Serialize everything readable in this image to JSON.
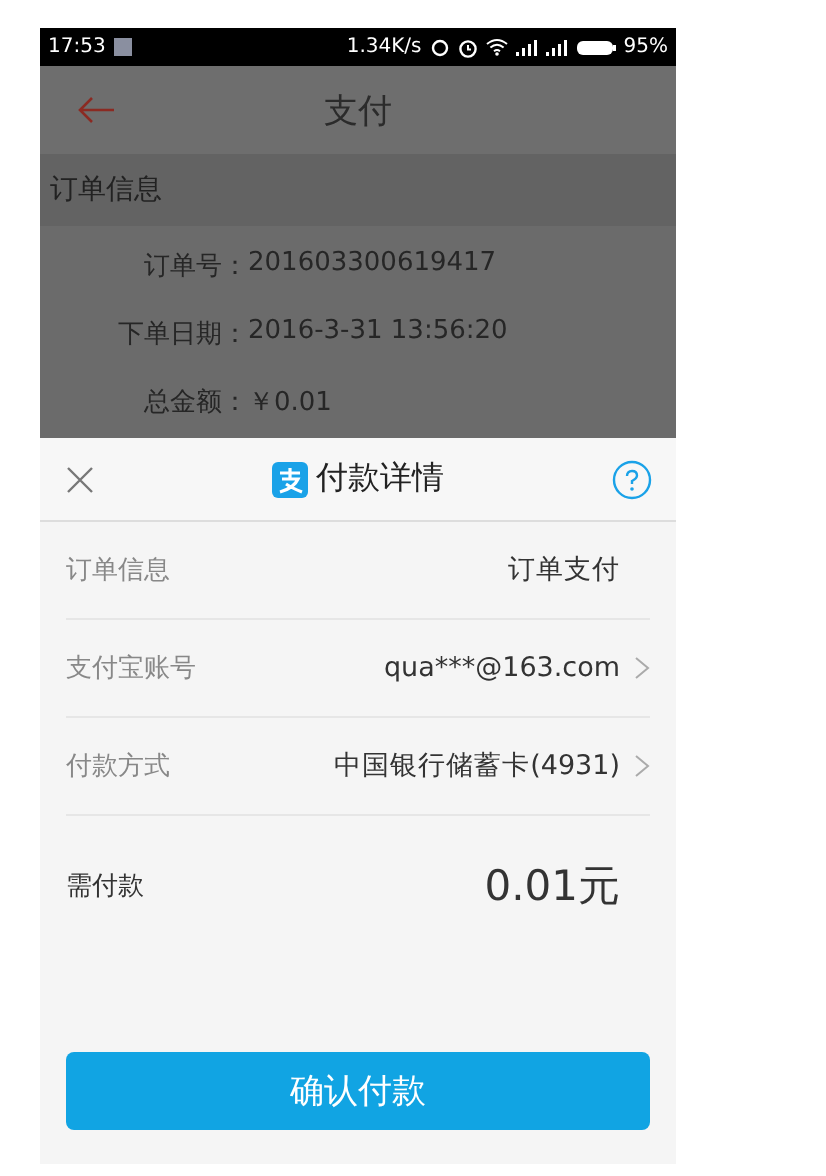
{
  "status_bar": {
    "time": "17:53",
    "network_speed": "1.34K/s",
    "battery": "95%"
  },
  "app_bar": {
    "title": "支付"
  },
  "order_info": {
    "header": "订单信息",
    "fields": [
      {
        "label": "订单号：",
        "value": "201603300619417"
      },
      {
        "label": "下单日期：",
        "value": "2016-3-31 13:56:20"
      },
      {
        "label": "总金额：",
        "value": "￥0.01"
      }
    ]
  },
  "payment_sheet": {
    "title": "付款详情",
    "rows": [
      {
        "label": "订单信息",
        "value": "订单支付",
        "has_arrow": false
      },
      {
        "label": "支付宝账号",
        "value": "qua***@163.com",
        "has_arrow": true
      },
      {
        "label": "付款方式",
        "value": "中国银行储蓄卡(4931)",
        "has_arrow": true
      }
    ],
    "amount_label": "需付款",
    "amount": "0.01元",
    "confirm_button": "确认付款"
  }
}
